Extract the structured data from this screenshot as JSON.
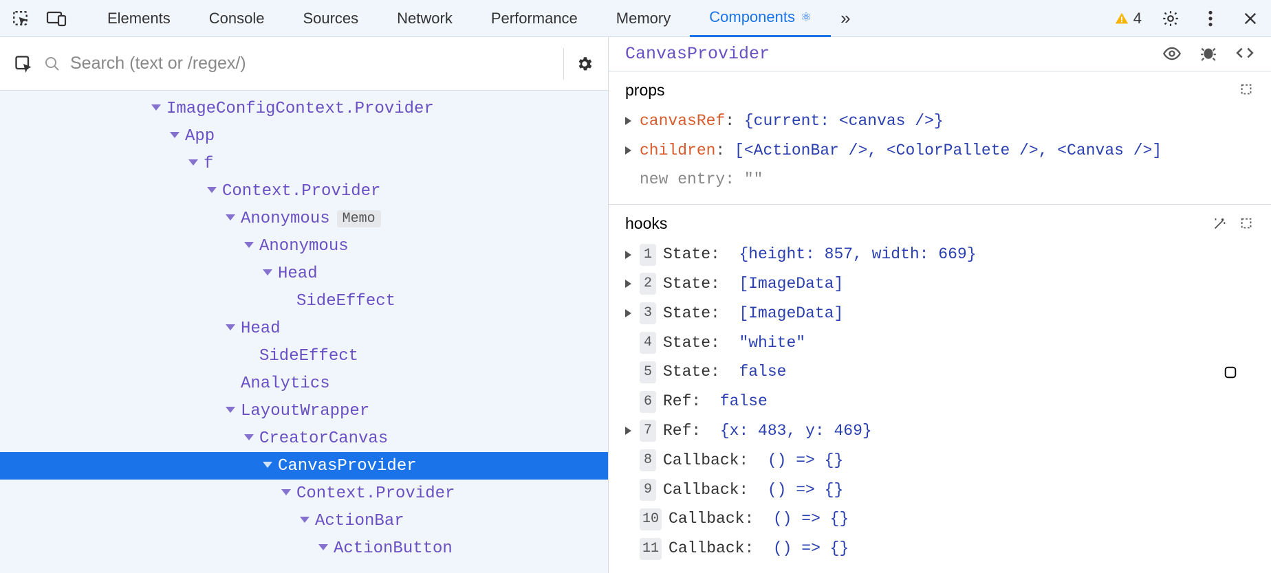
{
  "tabs": [
    "Elements",
    "Console",
    "Sources",
    "Network",
    "Performance",
    "Memory",
    "Components"
  ],
  "active_tab": 6,
  "warning_count": "4",
  "search": {
    "placeholder": "Search (text or /regex/)"
  },
  "tree": [
    {
      "indent": 0,
      "label": "ImageConfigContext.Provider",
      "caret": true
    },
    {
      "indent": 1,
      "label": "App",
      "caret": true
    },
    {
      "indent": 2,
      "label": "f",
      "caret": true
    },
    {
      "indent": 3,
      "label": "Context.Provider",
      "caret": true
    },
    {
      "indent": 4,
      "label": "Anonymous",
      "caret": true,
      "badge": "Memo"
    },
    {
      "indent": 5,
      "label": "Anonymous",
      "caret": true
    },
    {
      "indent": 6,
      "label": "Head",
      "caret": true
    },
    {
      "indent": 7,
      "label": "SideEffect",
      "caret": false
    },
    {
      "indent": 4,
      "label": "Head",
      "caret": true
    },
    {
      "indent": 5,
      "label": "SideEffect",
      "caret": false
    },
    {
      "indent": 4,
      "label": "Analytics",
      "caret": false
    },
    {
      "indent": 4,
      "label": "LayoutWrapper",
      "caret": true
    },
    {
      "indent": 5,
      "label": "CreatorCanvas",
      "caret": true
    },
    {
      "indent": 6,
      "label": "CanvasProvider",
      "caret": true,
      "selected": true
    },
    {
      "indent": 7,
      "label": "Context.Provider",
      "caret": true
    },
    {
      "indent": 8,
      "label": "ActionBar",
      "caret": true
    },
    {
      "indent": 9,
      "label": "ActionButton",
      "caret": true
    }
  ],
  "right": {
    "title": "CanvasProvider",
    "props_label": "props",
    "hooks_label": "hooks",
    "props": [
      {
        "caret": true,
        "key": "canvasRef",
        "value": "{current: <canvas />}",
        "orange": true
      },
      {
        "caret": true,
        "key": "children",
        "value": "[<ActionBar />, <ColorPallete />, <Canvas />]",
        "orange": true
      },
      {
        "caret": false,
        "key": "new entry",
        "value": "\"\"",
        "orange": false,
        "new": true
      }
    ],
    "hooks": [
      {
        "n": "1",
        "caret": true,
        "label": "State",
        "value": "{height: 857, width: 669}"
      },
      {
        "n": "2",
        "caret": true,
        "label": "State",
        "value": "[ImageData]"
      },
      {
        "n": "3",
        "caret": true,
        "label": "State",
        "value": "[ImageData]"
      },
      {
        "n": "4",
        "caret": false,
        "label": "State",
        "value": "\"white\""
      },
      {
        "n": "5",
        "caret": false,
        "label": "State",
        "value": "false",
        "extra_icon": true
      },
      {
        "n": "6",
        "caret": false,
        "label": "Ref",
        "value": "false"
      },
      {
        "n": "7",
        "caret": true,
        "label": "Ref",
        "value": "{x: 483, y: 469}"
      },
      {
        "n": "8",
        "caret": false,
        "label": "Callback",
        "value": "() => {}"
      },
      {
        "n": "9",
        "caret": false,
        "label": "Callback",
        "value": "() => {}"
      },
      {
        "n": "10",
        "caret": false,
        "label": "Callback",
        "value": "() => {}"
      },
      {
        "n": "11",
        "caret": false,
        "label": "Callback",
        "value": "() => {}"
      }
    ]
  }
}
